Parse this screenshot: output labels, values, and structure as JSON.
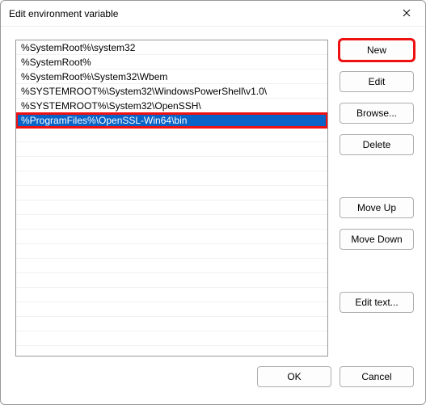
{
  "window": {
    "title": "Edit environment variable"
  },
  "list": {
    "items": [
      {
        "value": "%SystemRoot%\\system32",
        "selected": false
      },
      {
        "value": "%SystemRoot%",
        "selected": false
      },
      {
        "value": "%SystemRoot%\\System32\\Wbem",
        "selected": false
      },
      {
        "value": "%SYSTEMROOT%\\System32\\WindowsPowerShell\\v1.0\\",
        "selected": false
      },
      {
        "value": "%SYSTEMROOT%\\System32\\OpenSSH\\",
        "selected": false
      },
      {
        "value": "%ProgramFiles%\\OpenSSL-Win64\\bin",
        "selected": true
      }
    ],
    "empty_rows": 16
  },
  "buttons": {
    "new": "New",
    "edit": "Edit",
    "browse": "Browse...",
    "delete": "Delete",
    "move_up": "Move Up",
    "move_down": "Move Down",
    "edit_text": "Edit text...",
    "ok": "OK",
    "cancel": "Cancel"
  },
  "highlight": {
    "new_button": true,
    "selected_item": true
  }
}
